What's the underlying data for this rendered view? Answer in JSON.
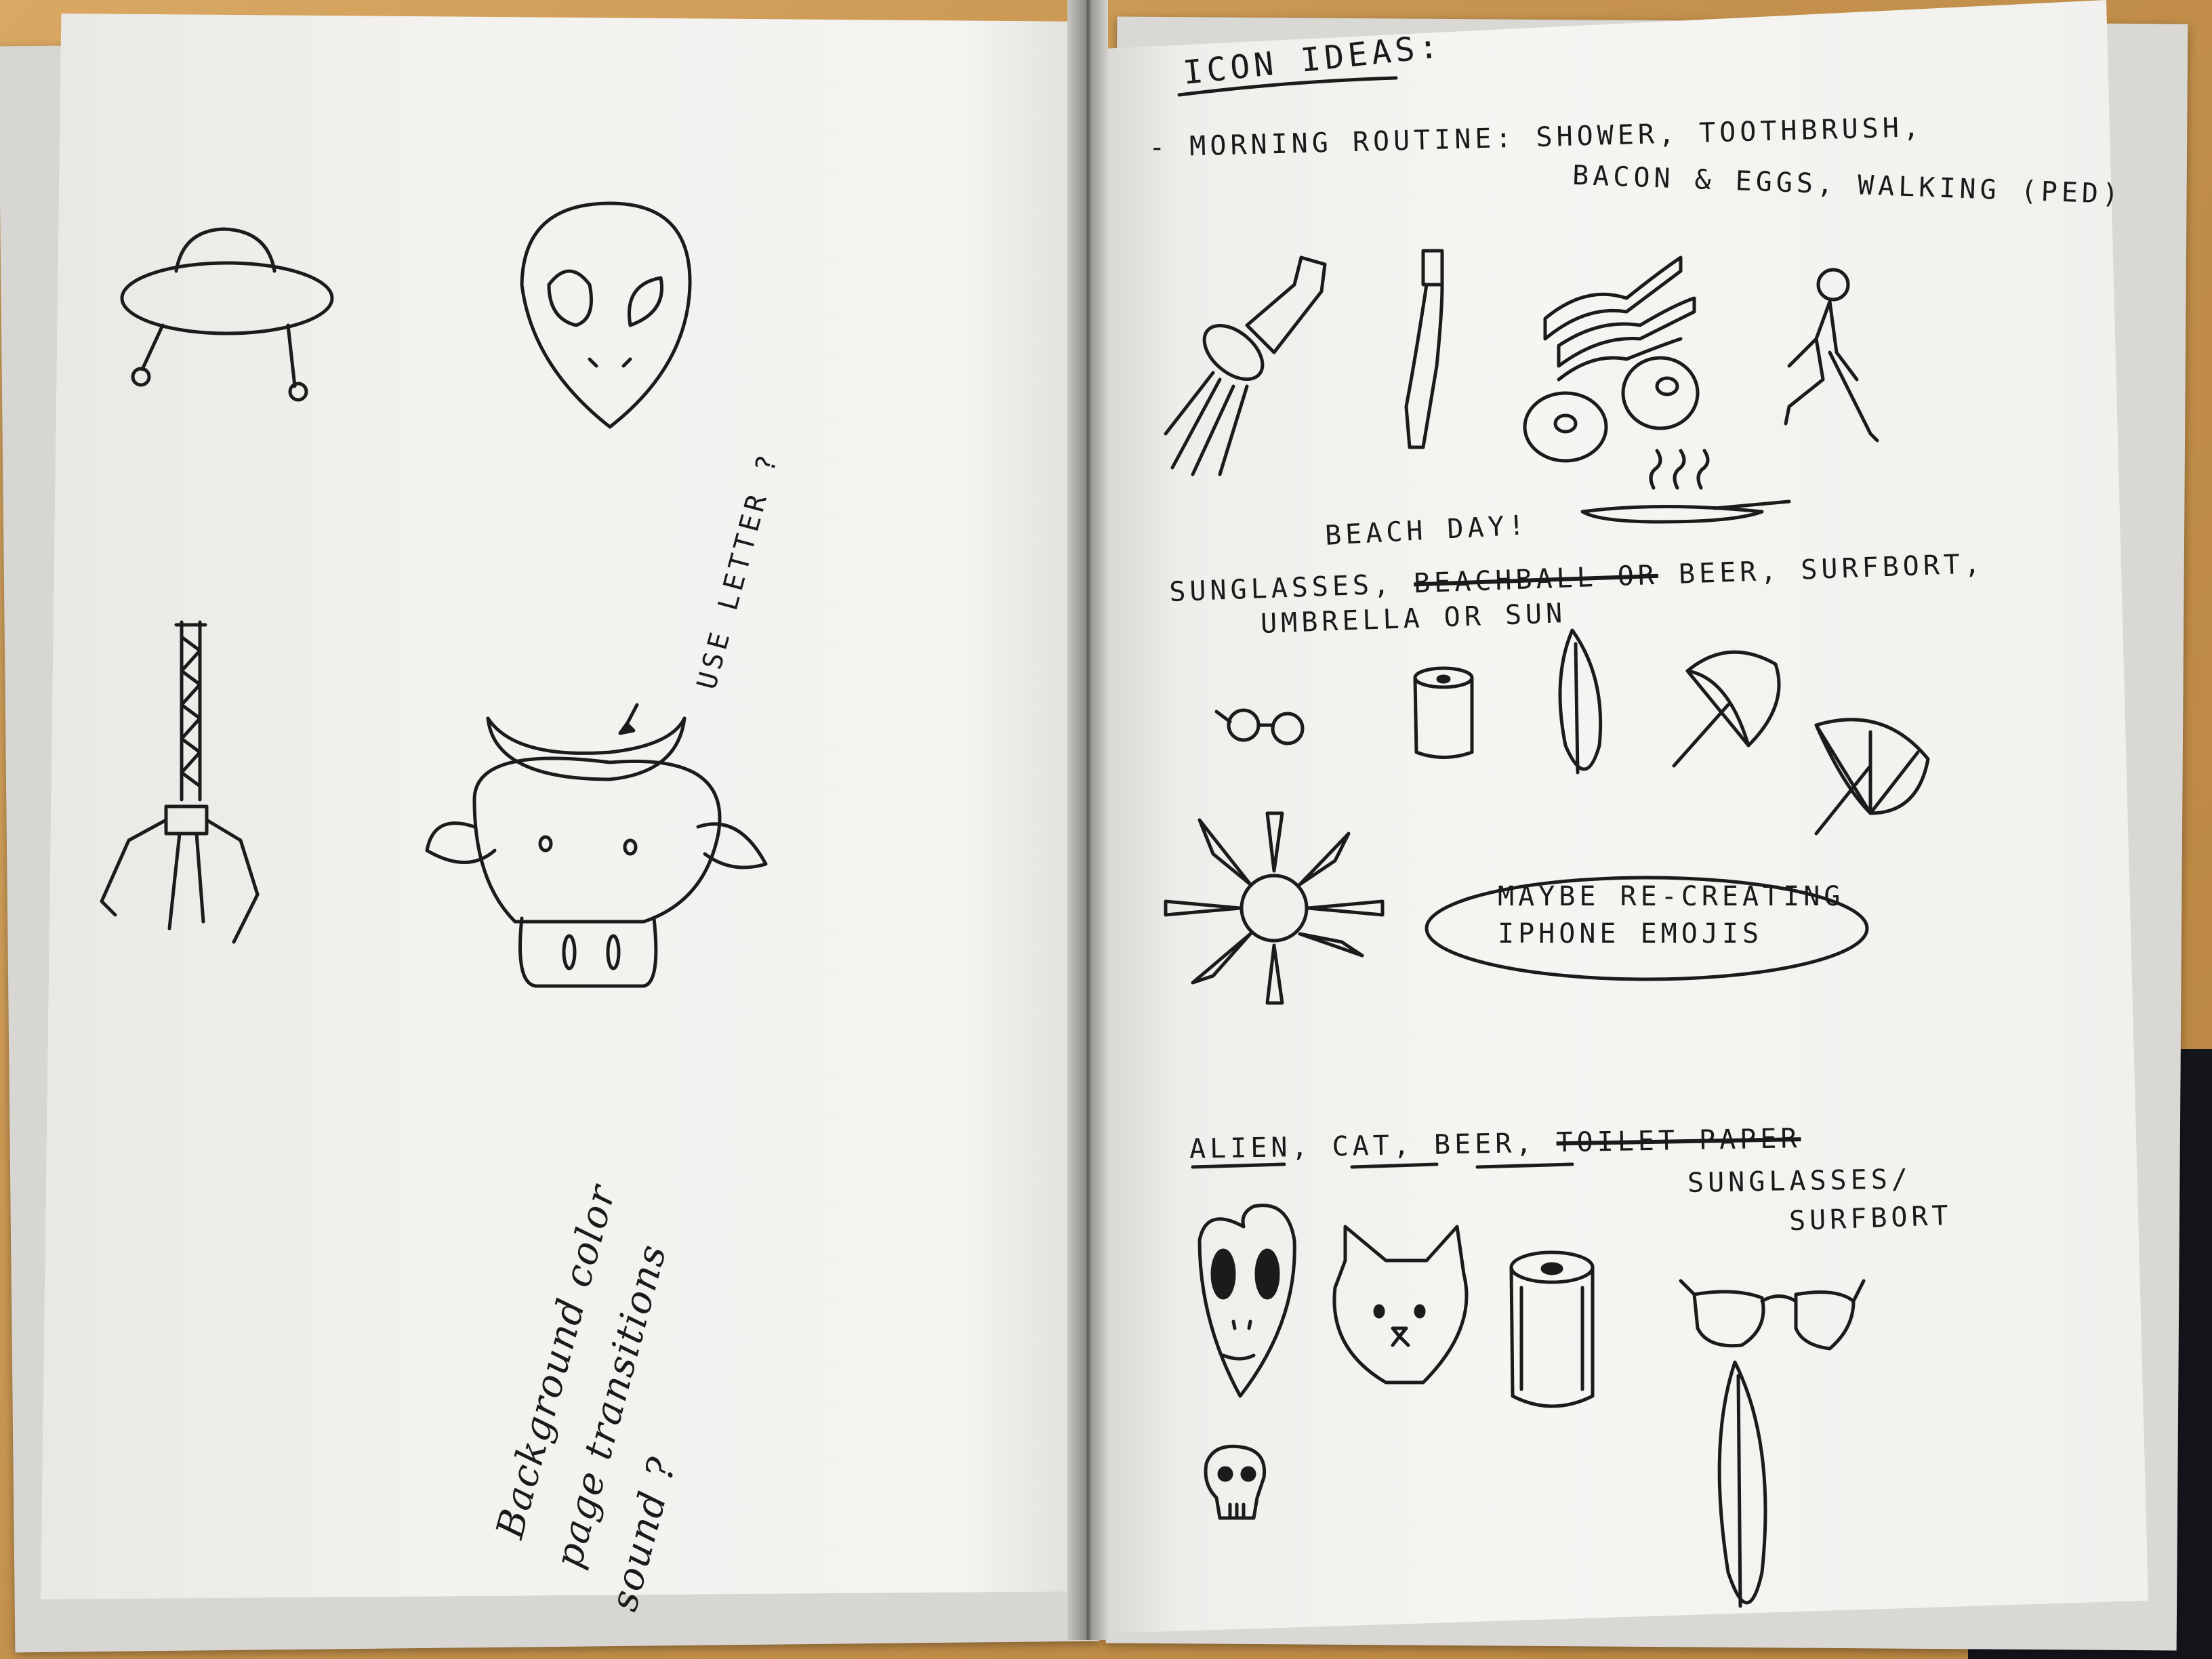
{
  "left_page": {
    "note_vertical": "USE LETTER ?",
    "notes_rotated": [
      "Background color",
      "page transitions",
      "sound ?"
    ]
  },
  "right_page": {
    "title": "ICON IDEAS:",
    "morning": {
      "line1": "- MORNING ROUTINE: SHOWER, TOOTHBRUSH,",
      "line2": "BACON & EGGS, WALKING (PED)"
    },
    "beach": {
      "heading": "BEACH DAY!",
      "line1_start": "SUNGLASSES,",
      "line1_struck": "BEACHBALL OR",
      "line1_end": "BEER, SURFBORT,",
      "line2": "UMBRELLA OR SUN"
    },
    "bubble": {
      "line1": "MAYBE RE-CREATING",
      "line2": "IPHONE EMOJIS"
    },
    "final_list": {
      "item1": "ALIEN",
      "item2": "CAT",
      "item3": "BEER",
      "struck": "TOILET PAPER",
      "line2": "SUNGLASSES/",
      "line3": "SURFBORT"
    }
  },
  "icon_sketches": [
    "ufo-icon",
    "alien-head-icon",
    "claw-crane-icon",
    "cow-head-icon",
    "shower-head-icon",
    "toothbrush-icon",
    "bacon-eggs-icon",
    "walking-person-icon",
    "frying-pan-icon",
    "sunglasses-icon",
    "beer-can-icon",
    "surfboard-icon",
    "umbrella-icon",
    "sun-icon",
    "alien-mask-icon",
    "cat-face-icon",
    "skull-icon"
  ]
}
